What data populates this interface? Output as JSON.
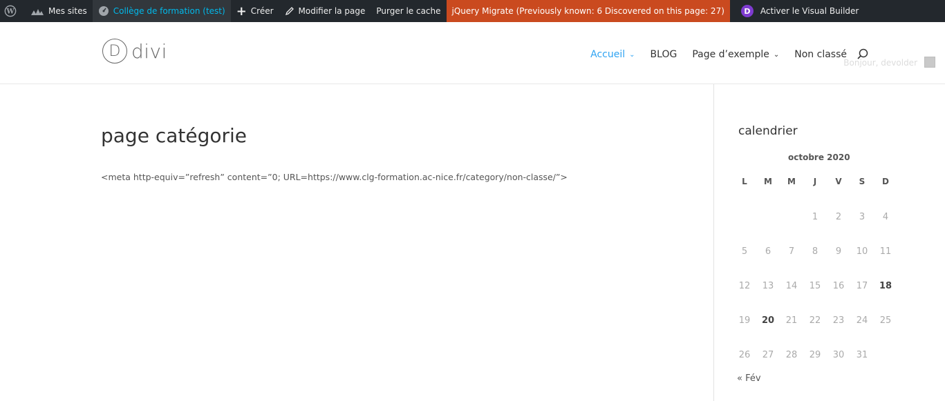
{
  "adminbar": {
    "wp_icon": "wordpress-icon",
    "my_sites": "Mes sites",
    "site_name": "Collège de formation (test)",
    "create": "Créer",
    "edit_page": "Modifier la page",
    "purge_cache": "Purger le cache",
    "jquery_migrate": "jQuery Migrate (Previously known: 6 Discovered on this page: 27)",
    "divi_badge": "D",
    "visual_builder": "Activer le Visual Builder"
  },
  "header": {
    "logo_letter": "D",
    "logo_text": "divi",
    "nav": [
      {
        "label": "Accueil",
        "has_dropdown": true,
        "active": true
      },
      {
        "label": "BLOG",
        "has_dropdown": false,
        "active": false
      },
      {
        "label": "Page d’exemple",
        "has_dropdown": true,
        "active": false
      },
      {
        "label": "Non classé",
        "has_dropdown": false,
        "active": false
      }
    ],
    "greeting": "Bonjour, devolder",
    "chevron": "⌄"
  },
  "main": {
    "title": "page catégorie",
    "content": "<meta http-equiv=”refresh” content=”0; URL=https://www.clg-formation.ac-nice.fr/category/non-classe/”>"
  },
  "calendar": {
    "title": "calendrier",
    "caption": "octobre 2020",
    "days": [
      "L",
      "M",
      "M",
      "J",
      "V",
      "S",
      "D"
    ],
    "weeks": [
      [
        "",
        "",
        "",
        "1",
        "2",
        "3",
        "4"
      ],
      [
        "5",
        "6",
        "7",
        "8",
        "9",
        "10",
        "11"
      ],
      [
        "12",
        "13",
        "14",
        "15",
        "16",
        "17",
        "18"
      ],
      [
        "19",
        "20",
        "21",
        "22",
        "23",
        "24",
        "25"
      ],
      [
        "26",
        "27",
        "28",
        "29",
        "30",
        "31",
        ""
      ]
    ],
    "highlighted": [
      "18",
      "20"
    ],
    "prev_link": "« Fév"
  },
  "colors": {
    "adminbar_bg": "#23282d",
    "jquery_bg": "#ca4a1f",
    "accent": "#2ea3f2",
    "divi_purple": "#7e3bd0"
  }
}
